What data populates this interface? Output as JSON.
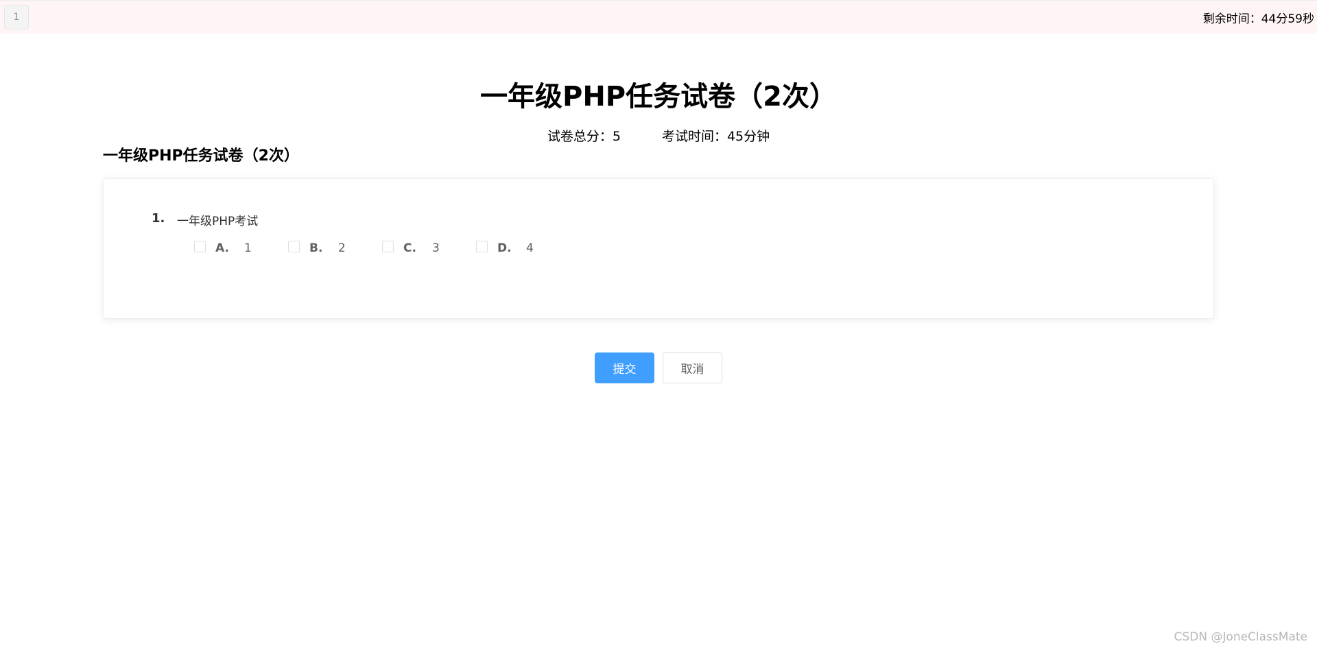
{
  "topbar": {
    "question_nav": [
      "1"
    ],
    "timer_text": "剩余时间：44分59秒"
  },
  "exam": {
    "title": "一年级PHP任务试卷（2次）",
    "total_score_label": "试卷总分：5",
    "exam_time_label": "考试时间：45分钟",
    "section_title": "一年级PHP任务试卷（2次）"
  },
  "question": {
    "number": "1.",
    "text": "一年级PHP考试",
    "options": [
      {
        "letter": "A.",
        "text": "1",
        "checked": false
      },
      {
        "letter": "B.",
        "text": "2",
        "checked": false
      },
      {
        "letter": "C.",
        "text": "3",
        "checked": false
      },
      {
        "letter": "D.",
        "text": "4",
        "checked": false
      }
    ]
  },
  "actions": {
    "submit_label": "提交",
    "cancel_label": "取消"
  },
  "watermark": "CSDN @JoneClassMate",
  "colors": {
    "primary": "#409eff",
    "topbar_bg": "#fef5f4"
  }
}
